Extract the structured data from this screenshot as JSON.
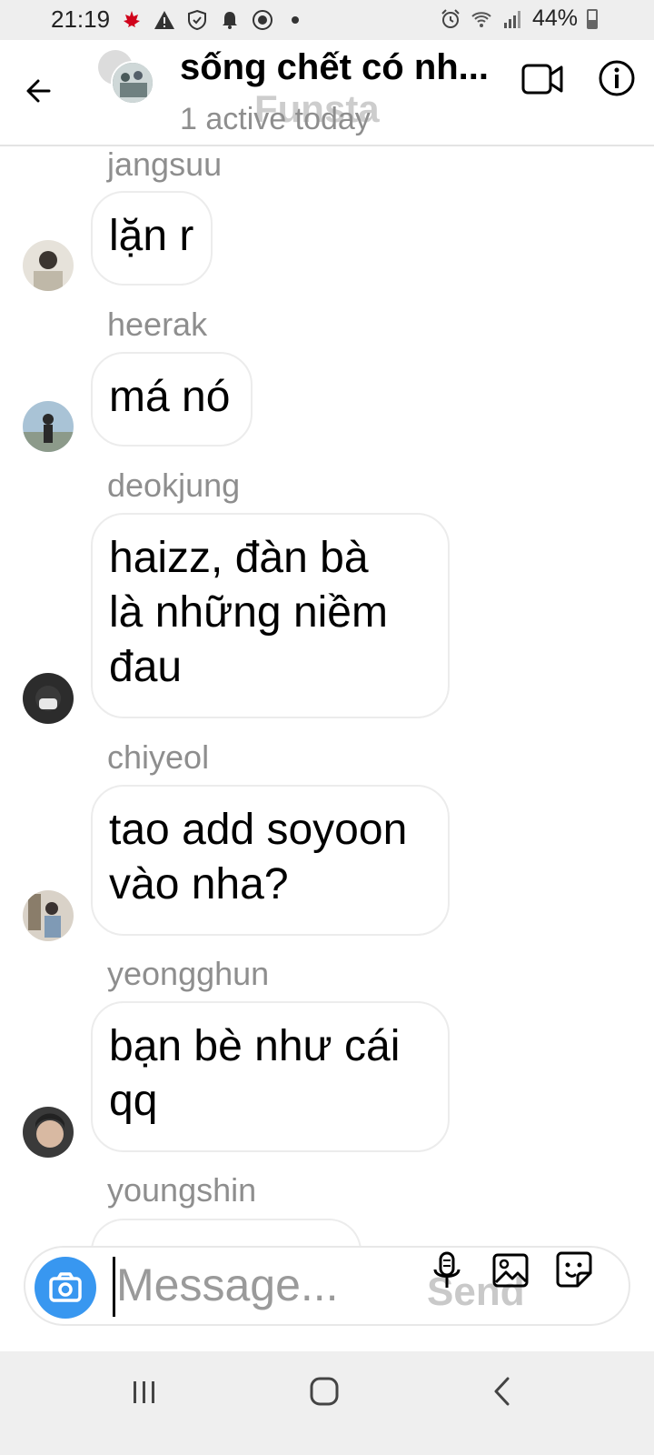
{
  "status_bar": {
    "time": "21:19",
    "battery_percent_text": "44%",
    "battery_level": 0.44,
    "icons": [
      "canada-flag-icon",
      "warning-icon",
      "shield-icon",
      "notification-bell-icon",
      "vpn-icon",
      "dot-icon",
      "alarm-icon",
      "wifi-icon",
      "signal-icon",
      "battery-icon"
    ]
  },
  "header": {
    "title": "sống chết có nh...",
    "subtitle": "1 active today",
    "watermark": "Funsta",
    "icons": [
      "back-arrow-icon",
      "video-call-icon",
      "info-icon"
    ]
  },
  "messages": [
    {
      "sender": "jangsuu",
      "lines": [
        "lặn r"
      ]
    },
    {
      "sender": "heerak",
      "lines": [
        "má nó"
      ]
    },
    {
      "sender": "deokjung",
      "lines": [
        "haizz, đàn bà",
        "là những niềm",
        "đau"
      ]
    },
    {
      "sender": "chiyeol",
      "lines": [
        "tao add soyoon",
        "vào nha?"
      ]
    },
    {
      "sender": "yeongghun",
      "lines": [
        "bạn bè như cái",
        "qq"
      ]
    },
    {
      "sender": "youngshin",
      "lines": []
    }
  ],
  "composer": {
    "placeholder": "Message...",
    "send_label": "Send",
    "accent_color": "#3897f0",
    "icons": [
      "camera-icon",
      "microphone-icon",
      "gallery-icon",
      "sticker-icon"
    ]
  },
  "nav_bar": {
    "icons": [
      "recent-apps-icon",
      "home-icon",
      "back-icon"
    ]
  }
}
